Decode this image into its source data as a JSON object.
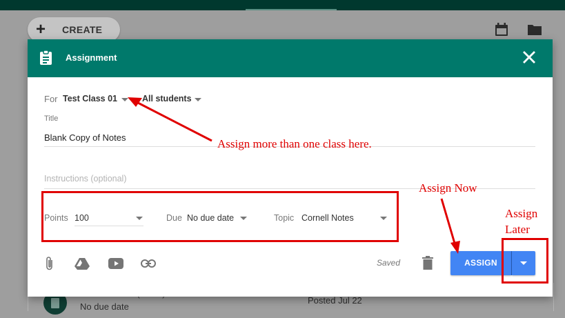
{
  "background": {
    "create_label": "CREATE",
    "create_icon": "plus-icon",
    "calendar_icon": "calendar-icon",
    "folder_icon": "folder-icon",
    "list_item_title": "Cornell Notes (Blank)",
    "list_item_due": "No due date",
    "list_item_posted": "Posted Jul 22"
  },
  "dialog": {
    "title": "Assignment",
    "header_color": "#00796b",
    "for_label": "For",
    "class_value": "Test Class 01",
    "students_value": "All students",
    "title_label": "Title",
    "title_value": "Blank Copy of Notes",
    "instructions_placeholder": "Instructions (optional)",
    "points_label": "Points",
    "points_value": "100",
    "due_label": "Due",
    "due_value": "No due date",
    "topic_label": "Topic",
    "topic_value": "Cornell Notes",
    "saved_text": "Saved",
    "assign_label": "ASSIGN",
    "assign_color": "#4285f4",
    "attach_icons": [
      "paperclip-icon",
      "google-drive-icon",
      "youtube-icon",
      "link-icon"
    ]
  },
  "annotations": {
    "assign_classes": "Assign more than one class here.",
    "assign_now": "Assign Now",
    "assign_later_line1": "Assign",
    "assign_later_line2": "Later",
    "color": "#e00000"
  }
}
